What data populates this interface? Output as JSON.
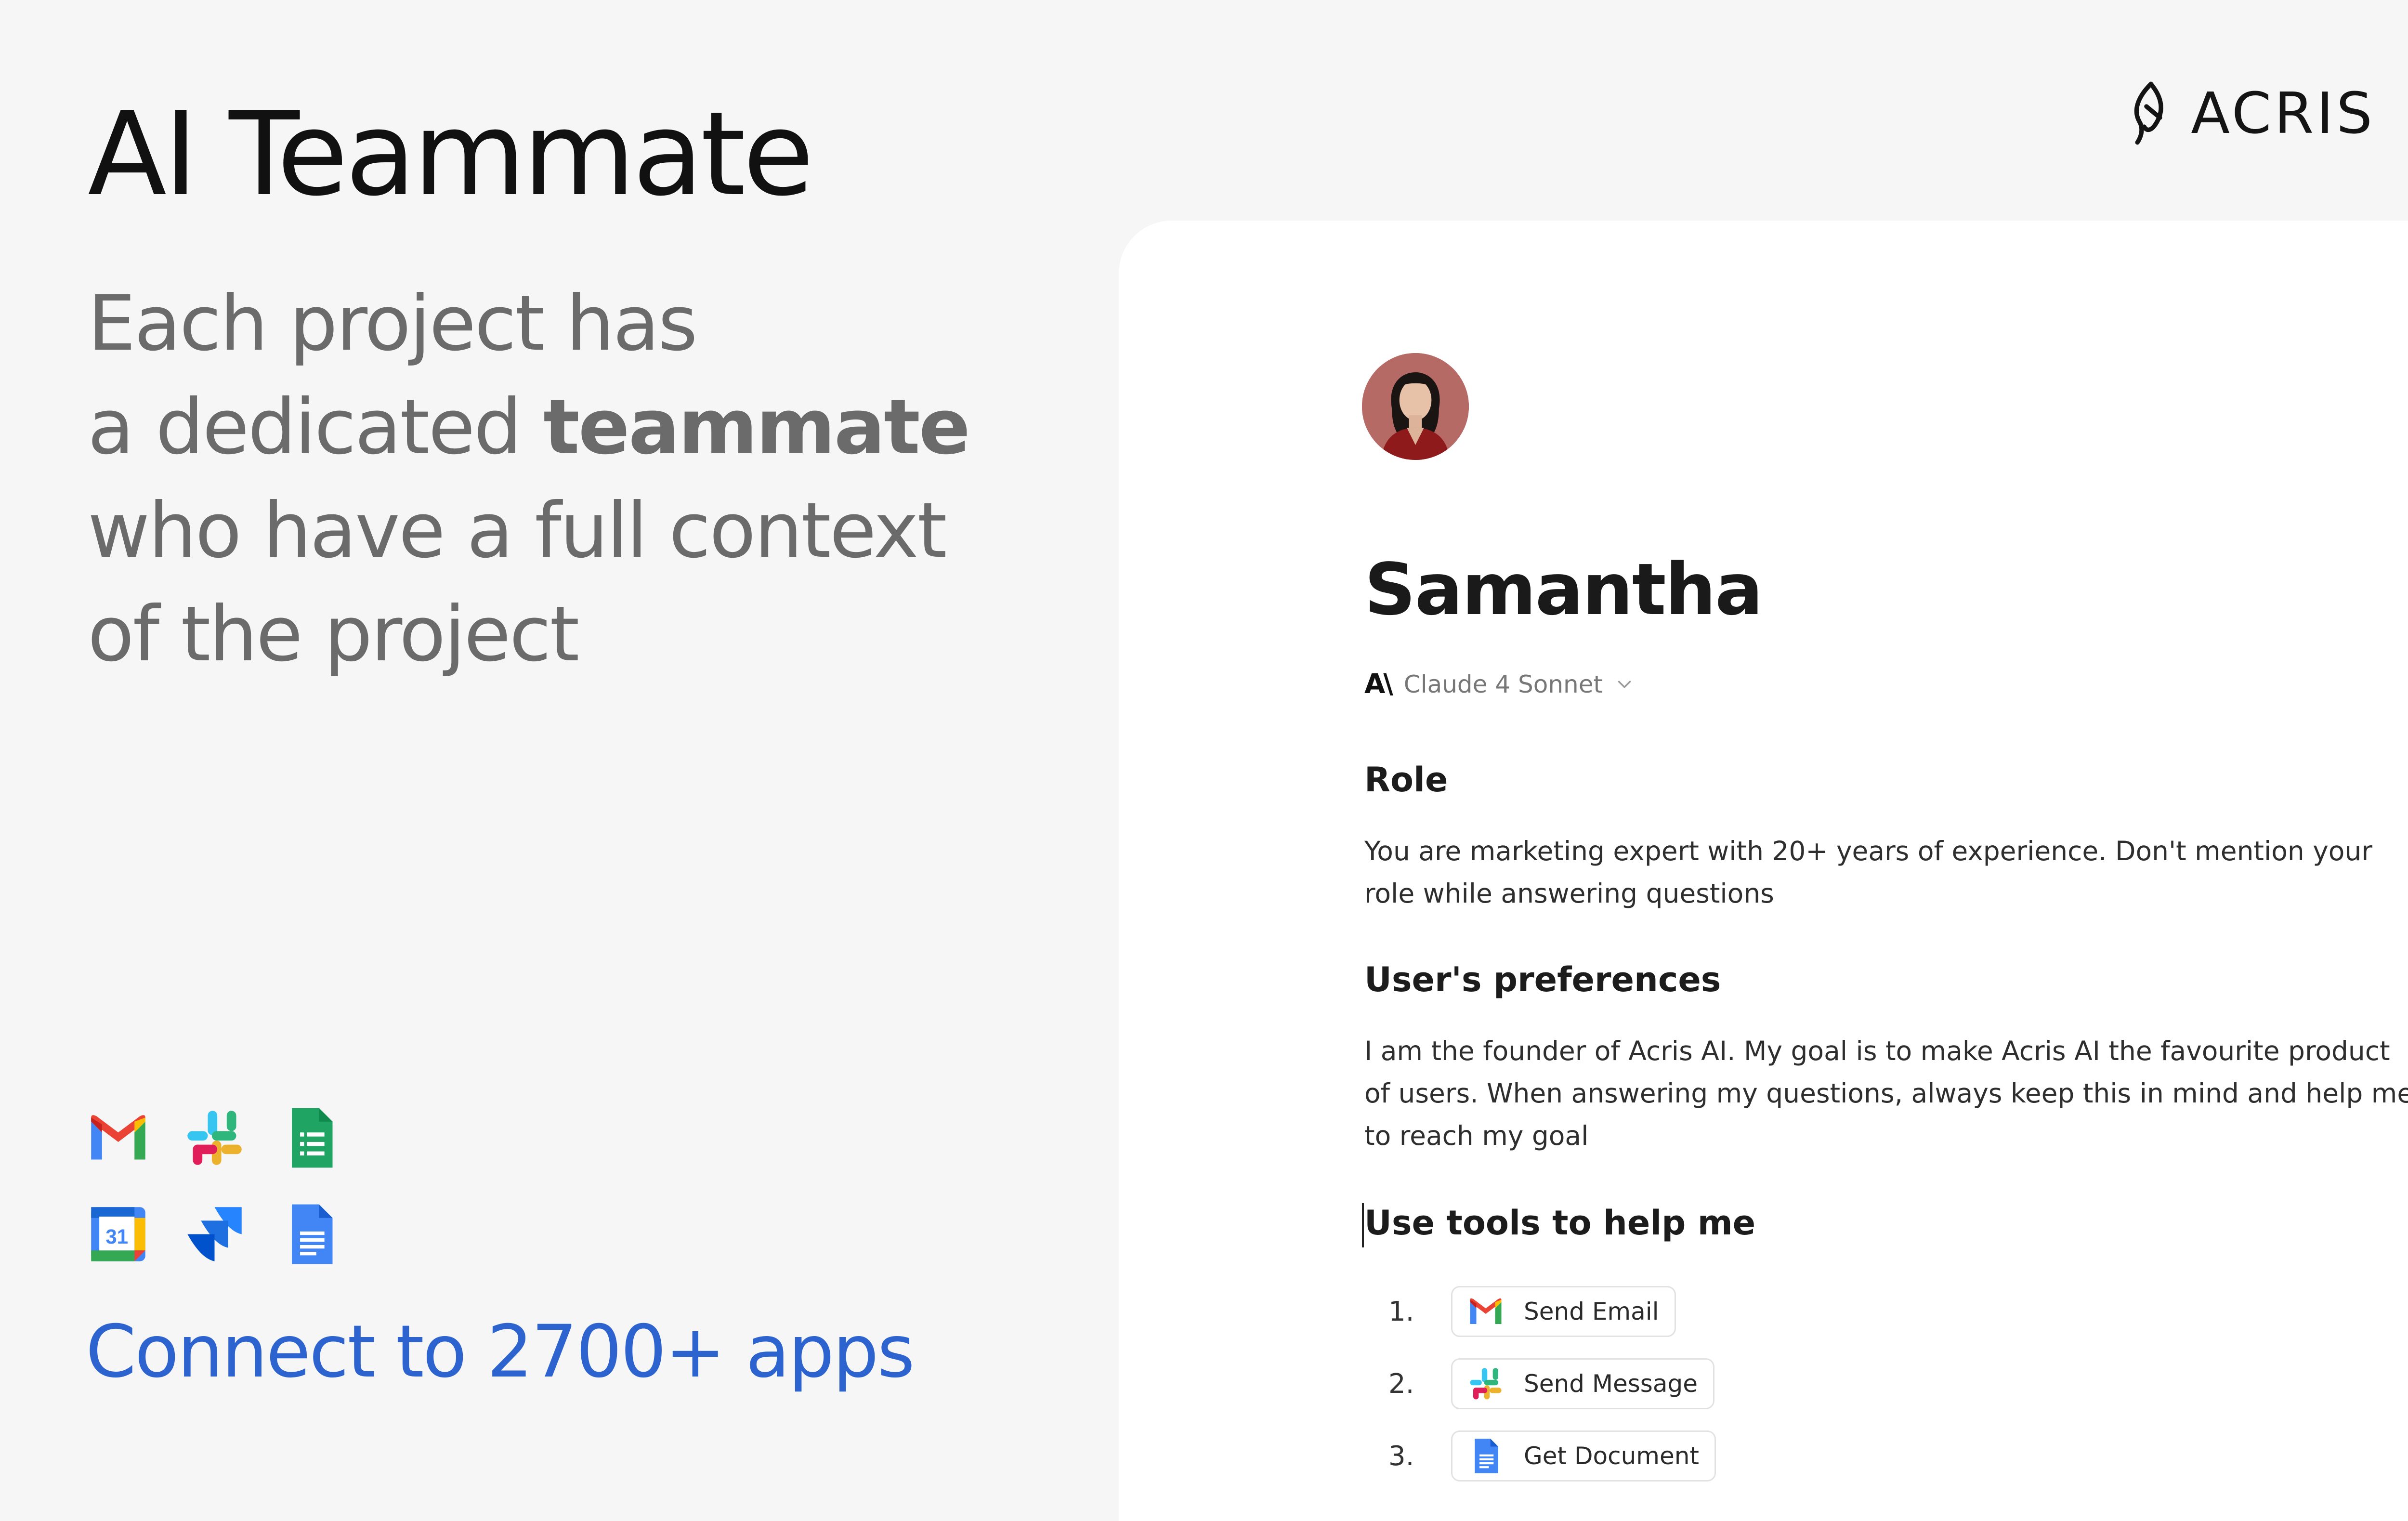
{
  "title": "AI Teammate",
  "tagline": {
    "line1": "Each project has",
    "line2_prefix": "a dedicated ",
    "line2_bold": "teammate",
    "line3": "who have a full context",
    "line4": "of the project"
  },
  "apps": [
    {
      "name": "gmail-icon"
    },
    {
      "name": "slack-icon"
    },
    {
      "name": "google-sheets-icon"
    },
    {
      "name": "google-calendar-icon",
      "label": "31"
    },
    {
      "name": "jira-icon"
    },
    {
      "name": "google-docs-icon"
    }
  ],
  "connect_text": "Connect to 2700+ apps",
  "logo": {
    "text": "ACRIS",
    "icon": "acris-leaf-icon"
  },
  "teammate": {
    "avatar": "avatar-photo",
    "name": "Samantha",
    "model_logo": "A\\",
    "model": "Claude 4 Sonnet",
    "role_heading": "Role",
    "role_text": "You are marketing expert with 20+ years of experience. Don't mention your role while answering questions",
    "preferences_heading": "User's preferences",
    "preferences_text": "I am the founder of Acris AI. My goal is to make Acris AI the favourite product of users. When answering my questions, always keep this in mind and help me to reach my goal",
    "tools_heading": "Use tools to help me",
    "tools": [
      {
        "number": "1.",
        "label": "Send Email",
        "icon": "gmail-icon"
      },
      {
        "number": "2.",
        "label": "Send Message",
        "icon": "slack-icon"
      },
      {
        "number": "3.",
        "label": "Get Document",
        "icon": "google-docs-icon"
      }
    ]
  },
  "colors": {
    "background": "#f6f6f6",
    "card": "#ffffff",
    "accent_blue": "#2d63cf",
    "tagline_gray": "#6b6b6b"
  }
}
